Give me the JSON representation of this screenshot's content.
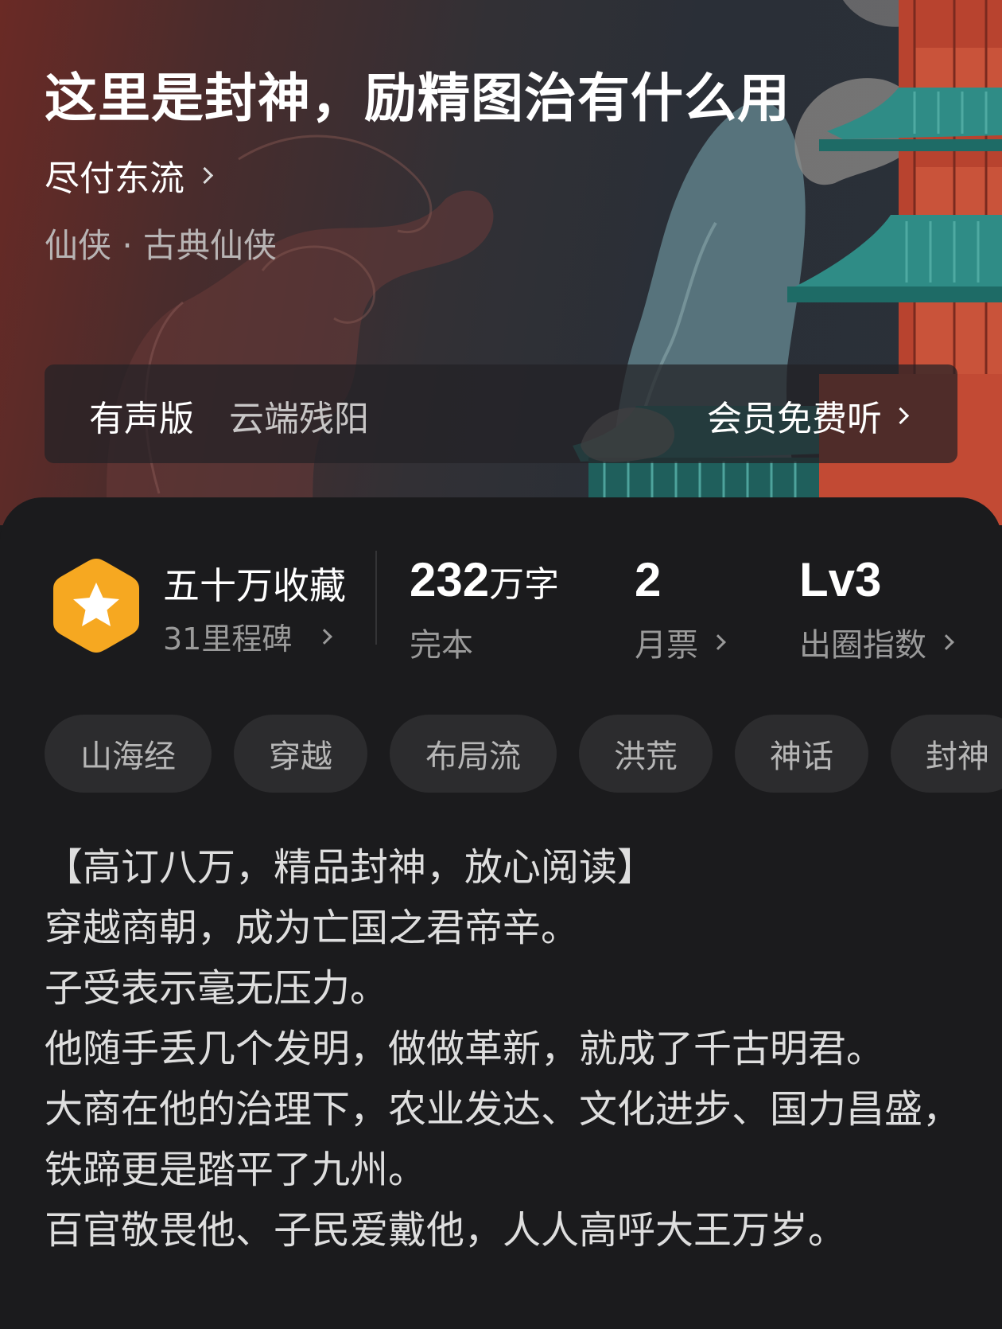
{
  "book": {
    "title": "这里是封神，励精图治有什么用",
    "author": "尽付东流",
    "genre": "仙侠 · 古典仙侠"
  },
  "audio": {
    "label": "有声版",
    "narrator": "云端残阳",
    "listen": "会员免费听"
  },
  "collection": {
    "title": "五十万收藏",
    "milestones": "31里程碑",
    "badge_icon": "star-icon",
    "badge_color": "#f5a623"
  },
  "stats": {
    "words_value": "232",
    "words_unit": "万字",
    "status": "完本",
    "monthly_ticket_value": "2",
    "monthly_ticket_label": "月票",
    "index_value": "Lv3",
    "index_label": "出圈指数"
  },
  "tags": [
    "山海经",
    "穿越",
    "布局流",
    "洪荒",
    "神话",
    "封神"
  ],
  "description": [
    "【高订八万，精品封神，放心阅读】",
    "穿越商朝，成为亡国之君帝辛。",
    "子受表示毫无压力。",
    "他随手丢几个发明，做做革新，就成了千古明君。",
    "大商在他的治理下，农业发达、文化进步、国力昌盛，铁蹄更是踏平了九州。",
    "百官敬畏他、子民爱戴他，人人高呼大王万岁。"
  ]
}
